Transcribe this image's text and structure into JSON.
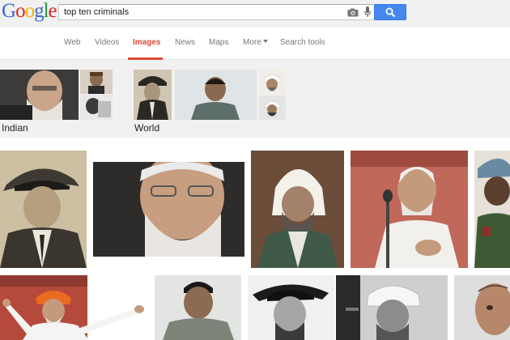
{
  "logo": {
    "letters": [
      "G",
      "o",
      "o",
      "g",
      "l",
      "e"
    ],
    "colors": [
      "#3b67d2",
      "#d62d20",
      "#f2b400",
      "#3b67d2",
      "#289a3c",
      "#d62d20"
    ]
  },
  "search": {
    "query": "top ten criminals"
  },
  "nav": {
    "tabs": [
      "Web",
      "Videos",
      "Images",
      "News",
      "Maps",
      "More",
      "Search tools"
    ],
    "active_tab": "Images",
    "active_color": "#dd4b39"
  },
  "related": {
    "categories": [
      "Indian",
      "World"
    ]
  },
  "icons": {
    "camera": "camera-icon",
    "mic": "microphone-icon",
    "search": "magnifier-icon",
    "more_caret": "caret-down-icon"
  },
  "theme": {
    "header_bg": "#f1f1f1",
    "search_button": "#4787ed"
  }
}
